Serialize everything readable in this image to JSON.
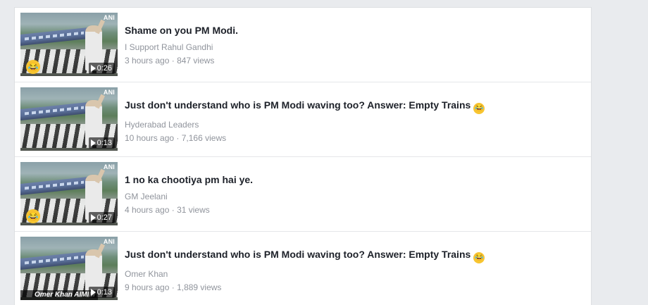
{
  "videos": [
    {
      "title": "Shame on you PM Modi.",
      "title_emoji": "",
      "page": "I Support Rahul Gandhi",
      "time": "3 hours ago",
      "views": "847 views",
      "duration": "0:26",
      "watermark": "ANI",
      "overlay_text": "",
      "emoji": "😂"
    },
    {
      "title": "Just don't understand who is PM Modi waving too? Answer: Empty Trains",
      "title_emoji": "😂",
      "page": "Hyderabad Leaders",
      "time": "10 hours ago",
      "views": "7,166 views",
      "duration": "0:13",
      "watermark": "ANI",
      "overlay_text": "",
      "emoji": ""
    },
    {
      "title": "1 no ka chootiya pm hai ye.",
      "title_emoji": "",
      "page": "GM Jeelani",
      "time": "4 hours ago",
      "views": "31 views",
      "duration": "0:27",
      "watermark": "ANI",
      "overlay_text": "",
      "emoji": "😂"
    },
    {
      "title": "Just don't understand who is PM Modi waving too? Answer: Empty Trains",
      "title_emoji": "😂",
      "page": "Omer Khan",
      "time": "9 hours ago",
      "views": "1,889 views",
      "duration": "0:13",
      "watermark": "ANI",
      "overlay_text": "Omer Khan AIMIM",
      "emoji": ""
    }
  ],
  "meta_separator": " · ",
  "colors": {
    "background": "#e9ebee",
    "title": "#1d2129",
    "meta": "#90949c"
  }
}
